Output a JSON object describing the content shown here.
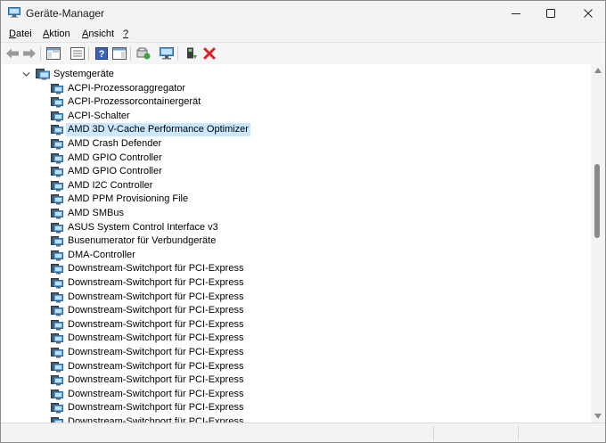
{
  "window": {
    "title": "Geräte-Manager"
  },
  "menu": [
    {
      "label_acc": "D",
      "label_rest": "atei"
    },
    {
      "label_acc": "A",
      "label_rest": "ktion"
    },
    {
      "label_acc": "A",
      "label_rest": "nsicht"
    },
    {
      "label_acc": "?",
      "label_rest": ""
    }
  ],
  "tree": {
    "category": "Systemgeräte",
    "selected_index": 3,
    "devices": [
      "ACPI-Prozessoraggregator",
      "ACPI-Prozessorcontainergerät",
      "ACPI-Schalter",
      "AMD 3D V-Cache Performance Optimizer",
      "AMD Crash Defender",
      "AMD GPIO Controller",
      "AMD GPIO Controller",
      "AMD I2C Controller",
      "AMD PPM Provisioning File",
      "AMD SMBus",
      "ASUS System Control Interface v3",
      "Busenumerator für Verbundgeräte",
      "DMA-Controller",
      "Downstream-Switchport für PCI-Express",
      "Downstream-Switchport für PCI-Express",
      "Downstream-Switchport für PCI-Express",
      "Downstream-Switchport für PCI-Express",
      "Downstream-Switchport für PCI-Express",
      "Downstream-Switchport für PCI-Express",
      "Downstream-Switchport für PCI-Express",
      "Downstream-Switchport für PCI-Express",
      "Downstream-Switchport für PCI-Express",
      "Downstream-Switchport für PCI-Express",
      "Downstream-Switchport für PCI-Express",
      "Downstream-Switchport für PCI-Express"
    ]
  },
  "colors": {
    "selection": "#cce8ff",
    "window_bg": "#f3f3f3",
    "content_bg": "#ffffff"
  },
  "icons": {
    "app": "device-manager-icon",
    "toolbar": [
      "back-arrow-icon",
      "forward-arrow-icon",
      "show-hide-console-tree-icon",
      "properties-icon",
      "help-icon",
      "action-pane-icon",
      "update-driver-icon",
      "scan-hardware-icon",
      "enable-device-icon",
      "uninstall-device-icon"
    ],
    "device": "system-device-icon",
    "category": "system-devices-category-icon"
  }
}
